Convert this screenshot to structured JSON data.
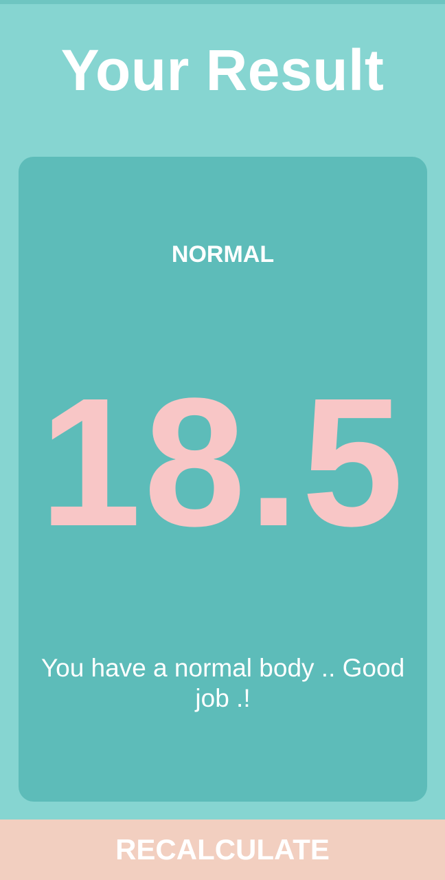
{
  "header": {
    "title": "Your Result"
  },
  "result": {
    "category": "NORMAL",
    "bmi_value": "18.5",
    "message": "You have a normal body .. Good job .!"
  },
  "footer": {
    "button_label": "RECALCULATE"
  },
  "colors": {
    "background": "#86d5d1",
    "card": "#5dbcb9",
    "value_text": "#f8c6c6",
    "button": "#f2cfc0",
    "text": "#ffffff"
  }
}
